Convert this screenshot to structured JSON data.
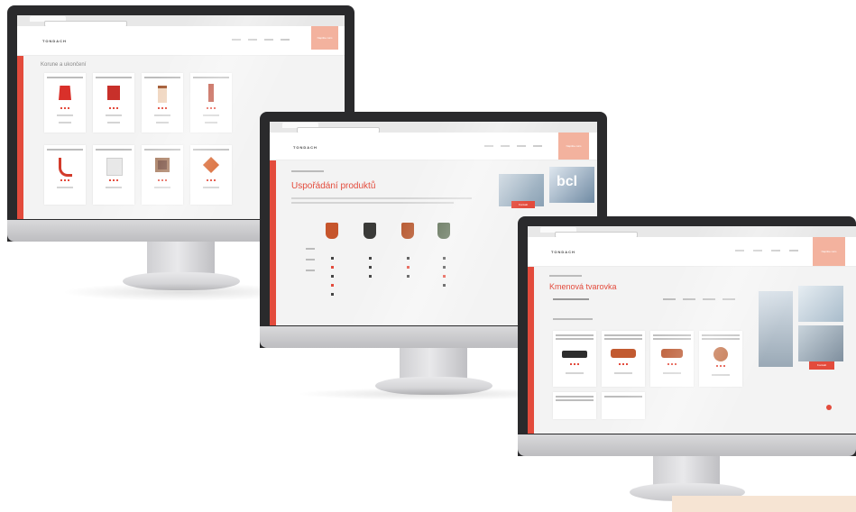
{
  "brand": {
    "logo_text": "TONDACH",
    "accent_color": "#e34b3c",
    "cta_color": "#f3b29e"
  },
  "monitors": [
    {
      "page_heading": "Korune a ukončení",
      "cta_label": "Napište nám",
      "cards": [
        {
          "icon": "ridge-tile-icon",
          "color": "#d9302a"
        },
        {
          "icon": "roof-tile-icon",
          "color": "#c8302a"
        },
        {
          "icon": "vent-tile-icon",
          "color": "#f0d6c0"
        },
        {
          "icon": "snow-guard-icon",
          "color": "#b8412d"
        },
        {
          "icon": "gutter-icon",
          "color": "#d33b2b"
        },
        {
          "icon": "membrane-icon",
          "color": "#e8e8e8"
        },
        {
          "icon": "window-tile-icon",
          "color": "#6b3c2b"
        },
        {
          "icon": "clay-tile-icon",
          "color": "#d8632c"
        }
      ]
    },
    {
      "page_heading": "Uspořádání produktů",
      "cta_label": "Napište nám",
      "photo_button": "Kontakt",
      "photo_text": "bcl",
      "product_colors": [
        "#c6552c",
        "#3a3a38",
        "#b5542a",
        "#465a3c"
      ]
    },
    {
      "page_heading": "Kmenová tvarovka",
      "cta_label": "Napište nám",
      "photo_button": "Kontakt",
      "product_colors": [
        "#2d2d2d",
        "#c25a30",
        "#b85229",
        "#c06a3f"
      ]
    }
  ]
}
